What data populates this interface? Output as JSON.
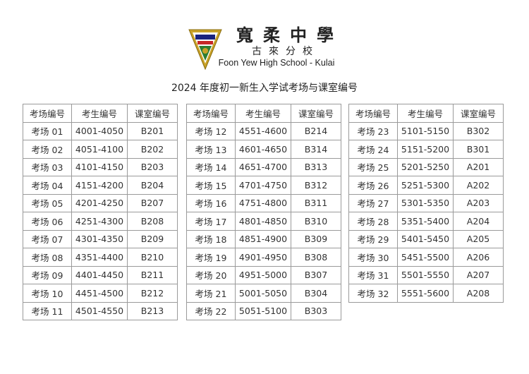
{
  "school": {
    "name_cn": "寬柔中學",
    "branch_cn": "古來分校",
    "name_en": "Foon Yew High School - Kulai"
  },
  "title": "2024 年度初一新生入学试考场与课室编号",
  "headers": [
    "考场编号",
    "考生编号",
    "课室编号"
  ],
  "tables": [
    [
      [
        "考场 01",
        "4001-4050",
        "B201"
      ],
      [
        "考场 02",
        "4051-4100",
        "B202"
      ],
      [
        "考场 03",
        "4101-4150",
        "B203"
      ],
      [
        "考场 04",
        "4151-4200",
        "B204"
      ],
      [
        "考场 05",
        "4201-4250",
        "B207"
      ],
      [
        "考场 06",
        "4251-4300",
        "B208"
      ],
      [
        "考场 07",
        "4301-4350",
        "B209"
      ],
      [
        "考场 08",
        "4351-4400",
        "B210"
      ],
      [
        "考场 09",
        "4401-4450",
        "B211"
      ],
      [
        "考场 10",
        "4451-4500",
        "B212"
      ],
      [
        "考场 11",
        "4501-4550",
        "B213"
      ]
    ],
    [
      [
        "考场 12",
        "4551-4600",
        "B214"
      ],
      [
        "考场 13",
        "4601-4650",
        "B314"
      ],
      [
        "考场 14",
        "4651-4700",
        "B313"
      ],
      [
        "考场 15",
        "4701-4750",
        "B312"
      ],
      [
        "考场 16",
        "4751-4800",
        "B311"
      ],
      [
        "考场 17",
        "4801-4850",
        "B310"
      ],
      [
        "考场 18",
        "4851-4900",
        "B309"
      ],
      [
        "考场 19",
        "4901-4950",
        "B308"
      ],
      [
        "考场 20",
        "4951-5000",
        "B307"
      ],
      [
        "考场 21",
        "5001-5050",
        "B304"
      ],
      [
        "考场 22",
        "5051-5100",
        "B303"
      ]
    ],
    [
      [
        "考场 23",
        "5101-5150",
        "B302"
      ],
      [
        "考场 24",
        "5151-5200",
        "B301"
      ],
      [
        "考场 25",
        "5201-5250",
        "A201"
      ],
      [
        "考场 26",
        "5251-5300",
        "A202"
      ],
      [
        "考场 27",
        "5301-5350",
        "A203"
      ],
      [
        "考场 28",
        "5351-5400",
        "A204"
      ],
      [
        "考场 29",
        "5401-5450",
        "A205"
      ],
      [
        "考场 30",
        "5451-5500",
        "A206"
      ],
      [
        "考场 31",
        "5501-5550",
        "A207"
      ],
      [
        "考场 32",
        "5551-5600",
        "A208"
      ]
    ]
  ],
  "colors": {
    "logo_gold": "#c9a227",
    "logo_green": "#2e7d32",
    "logo_red": "#c62828",
    "logo_navy": "#1a237e",
    "border": "#9a9a9a"
  }
}
